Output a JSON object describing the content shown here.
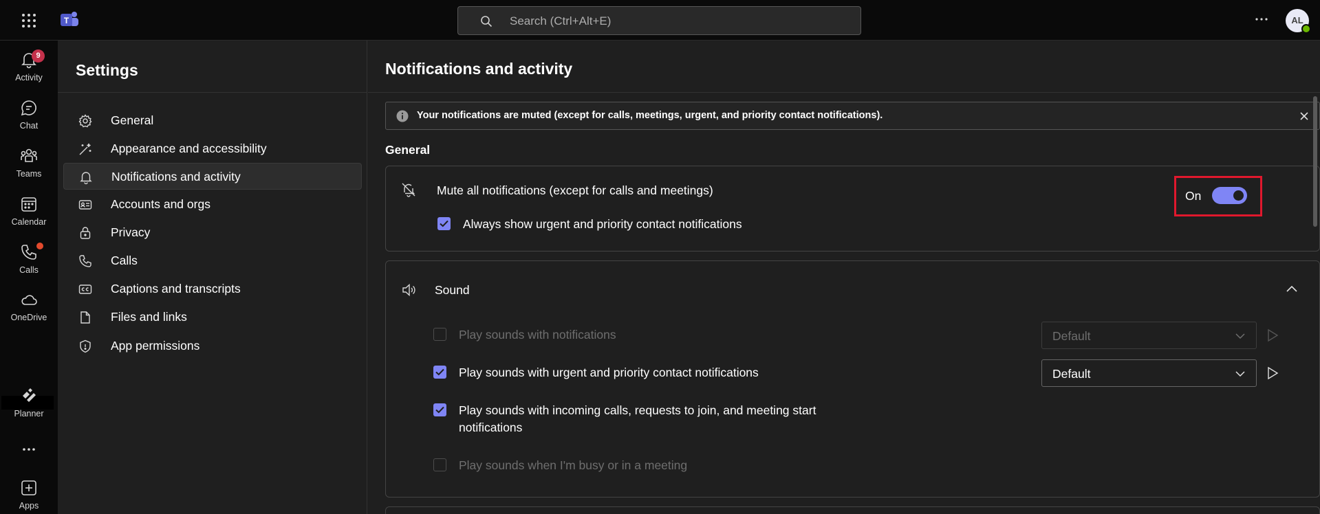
{
  "topbar": {
    "search_placeholder": "Search (Ctrl+Alt+E)",
    "avatar_initials": "AL"
  },
  "rail": {
    "items": [
      {
        "label": "Activity",
        "icon": "bell-icon",
        "badge": "9"
      },
      {
        "label": "Chat",
        "icon": "chat-icon"
      },
      {
        "label": "Teams",
        "icon": "teams-icon"
      },
      {
        "label": "Calendar",
        "icon": "calendar-icon"
      },
      {
        "label": "Calls",
        "icon": "phone-icon",
        "dot": true
      },
      {
        "label": "OneDrive",
        "icon": "cloud-icon"
      },
      {
        "label": "Planner",
        "icon": "planner-icon"
      },
      {
        "label": "Apps",
        "icon": "add-apps-icon"
      }
    ]
  },
  "settings": {
    "title": "Settings",
    "items": [
      {
        "label": "General",
        "icon": "gear-icon"
      },
      {
        "label": "Appearance and accessibility",
        "icon": "magic-wand-icon"
      },
      {
        "label": "Notifications and activity",
        "icon": "bell-icon",
        "active": true
      },
      {
        "label": "Accounts and orgs",
        "icon": "id-card-icon"
      },
      {
        "label": "Privacy",
        "icon": "lock-icon"
      },
      {
        "label": "Calls",
        "icon": "phone-icon"
      },
      {
        "label": "Captions and transcripts",
        "icon": "closed-captions-icon"
      },
      {
        "label": "Files and links",
        "icon": "document-icon"
      },
      {
        "label": "App permissions",
        "icon": "shield-icon"
      }
    ]
  },
  "main": {
    "title": "Notifications and activity",
    "banner": "Your notifications are muted (except for calls, meetings, urgent, and priority contact notifications).",
    "general_heading": "General",
    "mute": {
      "label": "Mute all notifications (except for calls and meetings)",
      "toggle_label": "On",
      "toggle_on": true,
      "urgent_label": "Always show urgent and priority contact notifications",
      "urgent_checked": true
    },
    "sound": {
      "label": "Sound",
      "rows": [
        {
          "label": "Play sounds with notifications",
          "checked": false,
          "disabled": true,
          "dropdown": "Default"
        },
        {
          "label": "Play sounds with urgent and priority contact notifications",
          "checked": true,
          "disabled": false,
          "dropdown": "Default"
        },
        {
          "label_line1": "Play sounds with incoming calls, requests to join, and meeting start",
          "label_line2": "notifications",
          "checked": true,
          "disabled": false
        },
        {
          "label": "Play sounds when I'm busy or in a meeting",
          "checked": false,
          "disabled": true
        }
      ]
    }
  },
  "colors": {
    "accent": "#7f85f5",
    "highlight_box": "#e0182d",
    "badge": "#c4314b",
    "background": "#1f1f1f"
  }
}
